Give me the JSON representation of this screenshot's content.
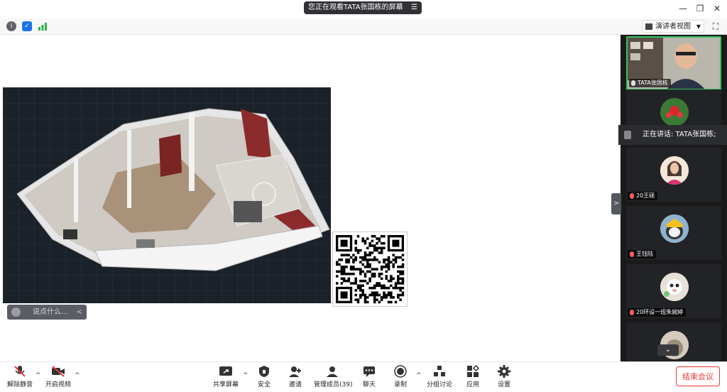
{
  "title_bar": {
    "viewing_text": "您正在观看TATA张国栋的屏幕",
    "viewing_menu_icon": "menu-lines-icon",
    "window_controls": [
      "minimize-icon",
      "restore-icon",
      "close-icon"
    ]
  },
  "info_bar": {
    "icons": [
      "info-icon",
      "shield-icon",
      "signal-bars-icon"
    ],
    "speaker_view_label": "演讲者视图",
    "fullscreen_icon": "fullscreen-icon"
  },
  "chat_input": {
    "placeholder": "说点什么...",
    "collapse_label": "<"
  },
  "sidebar": {
    "speaking_text": "正在讲话: TATA张国栋;",
    "participants": [
      {
        "name": "TATA张国栋",
        "muted": false
      },
      {
        "name": "",
        "muted": true
      },
      {
        "name": "20王硕",
        "muted": true
      },
      {
        "name": "王钰陆",
        "muted": true
      },
      {
        "name": "20环设一班朱婉婷",
        "muted": true
      },
      {
        "name": "",
        "muted": true
      }
    ],
    "toggle_label": ">",
    "scroll_down_label": "⌄"
  },
  "toolbar": {
    "unmute": "解除静音",
    "start_video": "开启视频",
    "share_screen": "共享屏幕",
    "security": "安全",
    "invite": "邀请",
    "manage_participants": "管理成员(39)",
    "chat": "聊天",
    "record": "录制",
    "breakout": "分组讨论",
    "apps": "应用",
    "settings": "设置",
    "end_meeting": "结束会议"
  },
  "colors": {
    "accent_red": "#e53935",
    "dark_panel": "#1a1a1a",
    "pill_bg": "#2f3136"
  }
}
